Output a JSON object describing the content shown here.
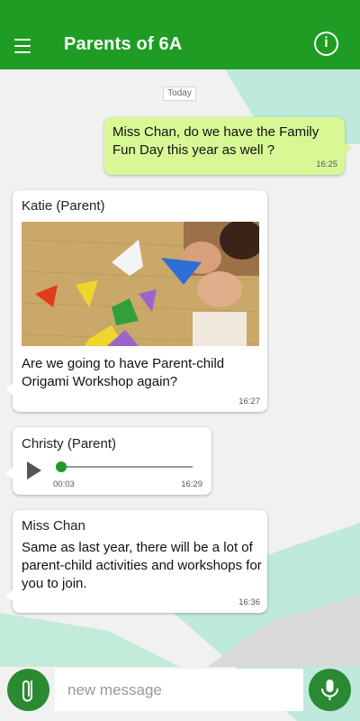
{
  "header": {
    "title": "Parents of 6A",
    "menu_icon": "hamburger-menu-icon",
    "info_icon": "info-icon",
    "info_glyph": "i",
    "color": "#1e9c23"
  },
  "conversation": {
    "date_label": "Today",
    "messages": [
      {
        "direction": "outgoing",
        "text": "Miss Chan, do we have the Family Fun Day this year as well ?",
        "time": "16:25"
      },
      {
        "direction": "incoming",
        "sender": "Katie (Parent)",
        "image": "origami-photo",
        "text": "Are we going to have Parent-child Origami Workshop again?",
        "time": "16:27"
      },
      {
        "direction": "incoming",
        "sender": "Christy (Parent)",
        "audio": {
          "elapsed": "00:03",
          "duration": "16:29",
          "progress": 0.0
        }
      },
      {
        "direction": "incoming",
        "sender": "Miss Chan",
        "text": "Same as last year, there will be a lot of parent-child activities and workshops for you to join.",
        "time": "16:36"
      }
    ]
  },
  "composer": {
    "placeholder": "new message",
    "attach_icon": "paperclip-icon",
    "mic_icon": "microphone-icon",
    "button_color": "#2a8a32"
  }
}
